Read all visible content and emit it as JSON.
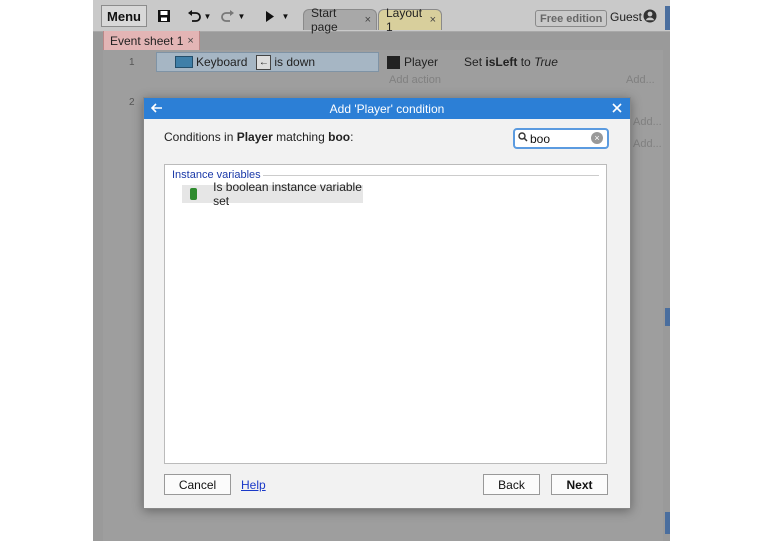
{
  "toolbar": {
    "menu_label": "Menu",
    "tabs": [
      {
        "label": "Start page",
        "close": "×"
      },
      {
        "label": "Layout 1",
        "close": "×"
      }
    ],
    "badge": "Free edition",
    "user_label": "Guest"
  },
  "sheet_tab": {
    "label": "Event sheet 1",
    "close": "×"
  },
  "event_sheet": {
    "rows": [
      {
        "number": "1",
        "condition_object": "Keyboard",
        "condition_key_glyph": "←",
        "condition_text": "is down",
        "action_object": "Player",
        "action_prefix": "Set ",
        "action_var": "isLeft",
        "action_mid": " to ",
        "action_value": "True",
        "add_action": "Add action",
        "add": "Add..."
      },
      {
        "number": "2",
        "add_links": [
          "Add...",
          "Add..."
        ]
      }
    ]
  },
  "dialog": {
    "title": "Add 'Player' condition",
    "heading_prefix": "Conditions in ",
    "heading_object": "Player",
    "heading_mid": " matching ",
    "heading_query": "boo",
    "heading_suffix": ":",
    "search_value": "boo",
    "group": "Instance variables",
    "items": [
      {
        "label": "Is boolean instance variable set"
      }
    ],
    "buttons": {
      "cancel": "Cancel",
      "help": "Help",
      "back": "Back",
      "next": "Next"
    }
  },
  "colors": {
    "title_bar": "#2c7fd6",
    "accent_link": "#1a39c8",
    "bool_icon": "#2e8b2e"
  }
}
